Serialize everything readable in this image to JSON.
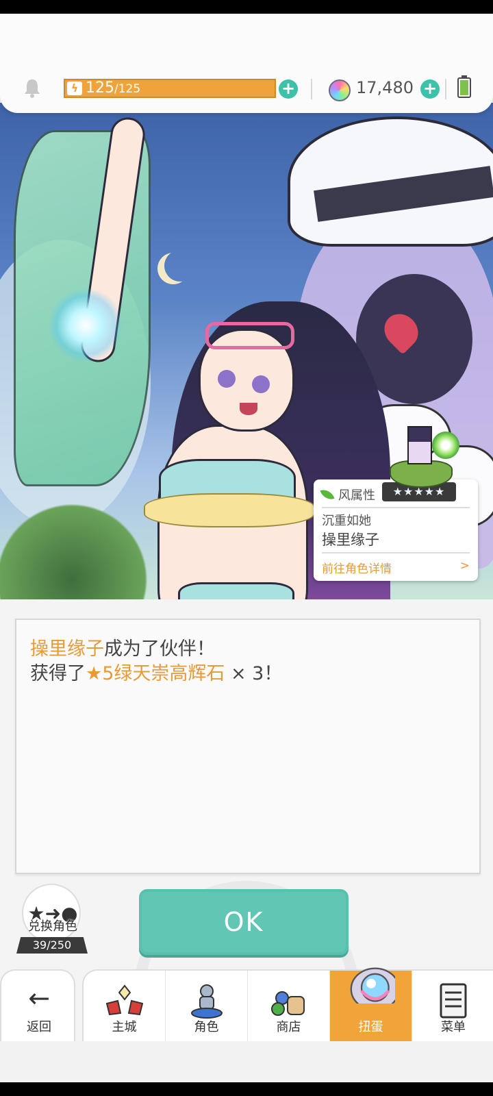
{
  "topbar": {
    "stamina_current": "125",
    "stamina_max": "/125",
    "gems": "17,480"
  },
  "character_card": {
    "element": "风属性",
    "stars": "★★★★★",
    "title": "沉重如她",
    "name": "操里缘子",
    "detail_link": "前往角色详情",
    "detail_arrow": ">"
  },
  "message": {
    "line1_name": "操里缘子",
    "line1_rest": "成为了伙伴！",
    "line2_prefix": "获得了",
    "line2_item": "★5绿天崇高辉石",
    "line2_suffix": " × 3！"
  },
  "exchange": {
    "label": "兑换角色",
    "count": "39/250"
  },
  "ok_button": {
    "label": "OK"
  },
  "nav": {
    "back": "返回",
    "items": [
      {
        "label": "主城",
        "icon": "castle-icon"
      },
      {
        "label": "角色",
        "icon": "character-icon"
      },
      {
        "label": "商店",
        "icon": "shop-icon"
      },
      {
        "label": "扭蛋",
        "icon": "gacha-icon"
      },
      {
        "label": "菜单",
        "icon": "menu-icon"
      }
    ]
  },
  "colors": {
    "accent_orange": "#f0a33c",
    "teal": "#62c6b4",
    "element_green": "#58b83c"
  }
}
